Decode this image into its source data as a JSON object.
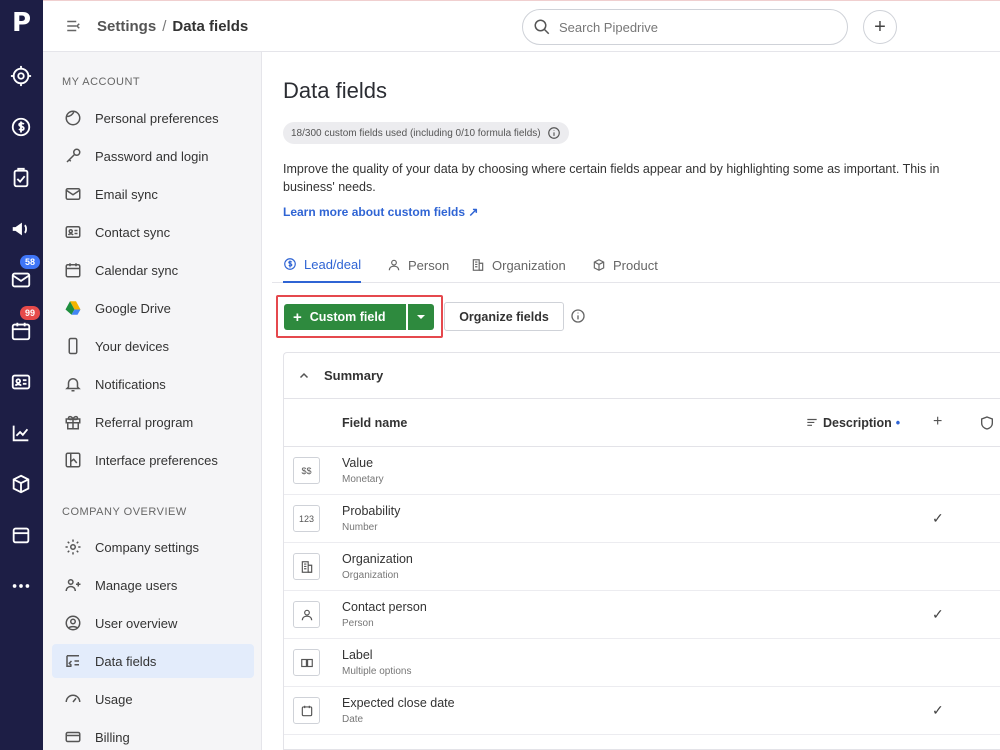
{
  "app": {
    "logo": "P"
  },
  "rail": {
    "items": [
      {
        "icon": "target-icon"
      },
      {
        "icon": "dollar-icon"
      },
      {
        "icon": "clipboard-icon"
      },
      {
        "icon": "megaphone-icon"
      },
      {
        "icon": "mail-icon",
        "badge": "58"
      },
      {
        "icon": "calendar-icon",
        "badge": "99"
      },
      {
        "icon": "contacts-icon"
      },
      {
        "icon": "chart-icon"
      },
      {
        "icon": "box-icon"
      },
      {
        "icon": "store-icon"
      },
      {
        "icon": "more-icon"
      }
    ]
  },
  "topbar": {
    "breadcrumb_root": "Settings",
    "breadcrumb_sep": "/",
    "breadcrumb_current": "Data fields",
    "search_placeholder": "Search Pipedrive",
    "add_label": "+"
  },
  "sidebar": {
    "my_account_title": "MY ACCOUNT",
    "my_account_items": [
      {
        "label": "Personal preferences",
        "icon": "face-icon"
      },
      {
        "label": "Password and login",
        "icon": "key-icon"
      },
      {
        "label": "Email sync",
        "icon": "mail-icon"
      },
      {
        "label": "Contact sync",
        "icon": "contact-card-icon"
      },
      {
        "label": "Calendar sync",
        "icon": "calendar-icon"
      },
      {
        "label": "Google Drive",
        "icon": "google-drive-icon"
      },
      {
        "label": "Your devices",
        "icon": "phone-icon"
      },
      {
        "label": "Notifications",
        "icon": "bell-icon"
      },
      {
        "label": "Referral program",
        "icon": "gift-icon"
      },
      {
        "label": "Interface preferences",
        "icon": "layout-icon"
      }
    ],
    "company_title": "COMPANY OVERVIEW",
    "company_items": [
      {
        "label": "Company settings",
        "icon": "gear-icon"
      },
      {
        "label": "Manage users",
        "icon": "users-icon"
      },
      {
        "label": "User overview",
        "icon": "user-circle-icon"
      },
      {
        "label": "Data fields",
        "icon": "data-fields-icon",
        "active": true
      },
      {
        "label": "Usage",
        "icon": "gauge-icon"
      },
      {
        "label": "Billing",
        "icon": "credit-card-icon"
      }
    ]
  },
  "main": {
    "title": "Data fields",
    "usage_chip": "18/300 custom fields used (including 0/10 formula fields)",
    "description_line1": "Improve the quality of your data by choosing where certain fields appear and by highlighting some as important. This in",
    "description_line2": "business' needs.",
    "learn_more": "Learn more about custom fields ↗",
    "tabs": [
      {
        "label": "Lead/deal",
        "icon": "dollar-circle-icon",
        "active": true
      },
      {
        "label": "Person",
        "icon": "person-icon"
      },
      {
        "label": "Organization",
        "icon": "building-icon"
      },
      {
        "label": "Product",
        "icon": "box-icon"
      }
    ],
    "custom_field_button": "Custom field",
    "organize_button": "Organize fields",
    "section_title": "Summary",
    "columns": {
      "field_name": "Field name",
      "description": "Description",
      "description_marker": "•",
      "add": "+"
    },
    "fields": [
      {
        "name": "Value",
        "type": "Monetary",
        "type_icon": "$$",
        "checked": false
      },
      {
        "name": "Probability",
        "type": "Number",
        "type_icon": "123",
        "checked": true
      },
      {
        "name": "Organization",
        "type": "Organization",
        "type_icon": "building-icon",
        "checked": false
      },
      {
        "name": "Contact person",
        "type": "Person",
        "type_icon": "person-icon",
        "checked": true
      },
      {
        "name": "Label",
        "type": "Multiple options",
        "type_icon": "options-icon",
        "checked": false
      },
      {
        "name": "Expected close date",
        "type": "Date",
        "type_icon": "calendar-icon",
        "checked": true
      }
    ],
    "check_mark": "✓"
  },
  "colors": {
    "rail": "#1d1e45",
    "accent_green": "#2e8a3e",
    "link_blue": "#2f64d4",
    "highlight_red": "#e5484d",
    "active_bg": "#e3ecfb"
  }
}
